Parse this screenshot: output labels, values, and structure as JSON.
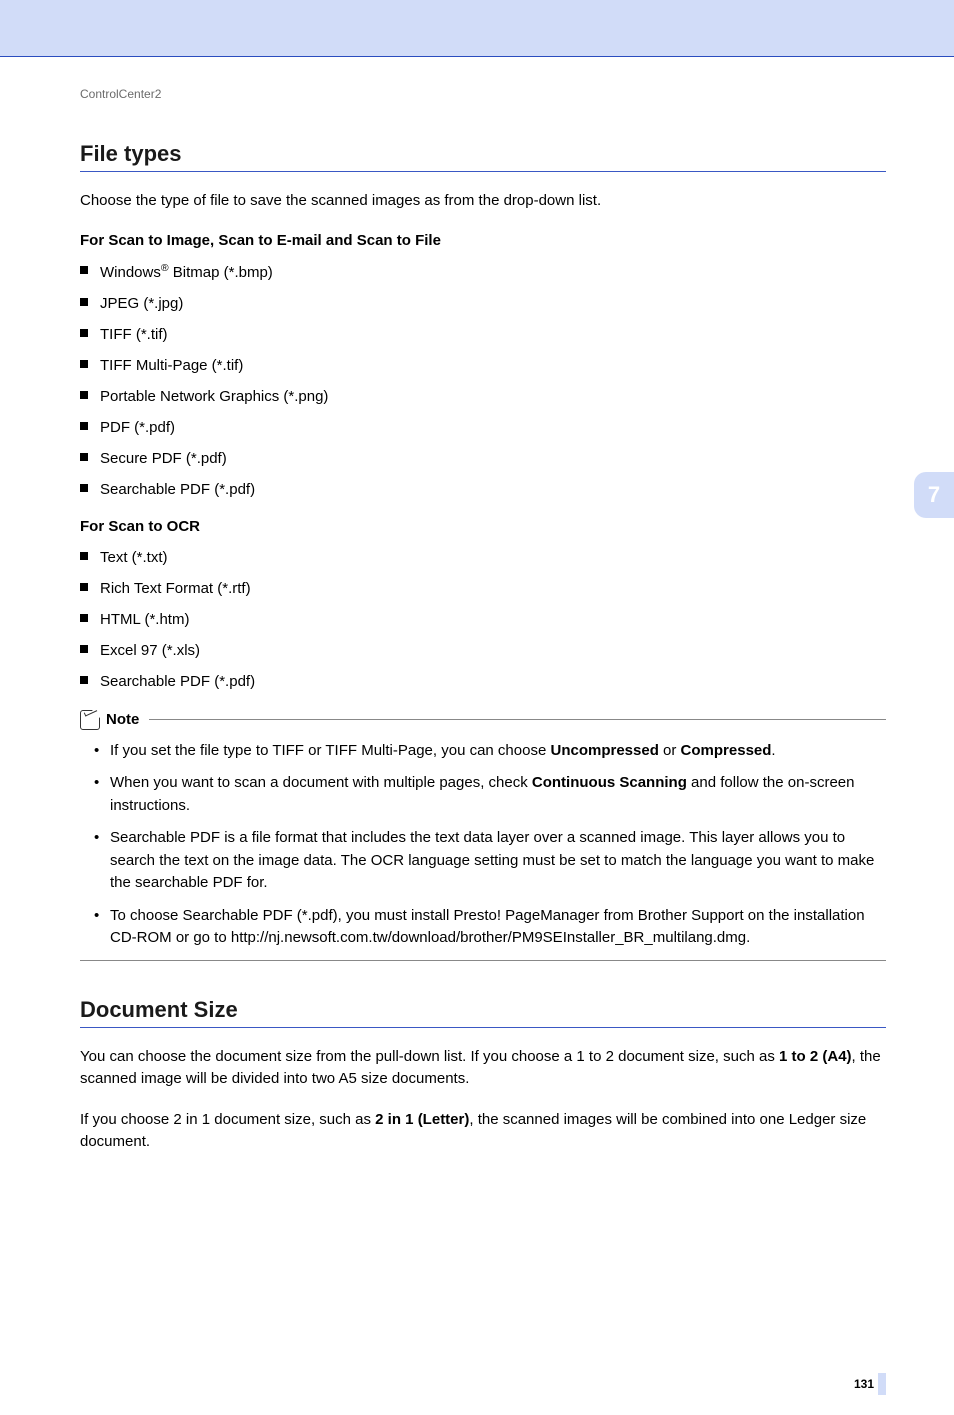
{
  "breadcrumb": "ControlCenter2",
  "chapter_tab": "7",
  "page_number": "131",
  "section1": {
    "heading": "File types",
    "intro": "Choose the type of file to save the scanned images as from the drop-down list.",
    "sub1_title": "For Scan to Image, Scan to E-mail and Scan to File",
    "sub1_items_prefix0": "Windows",
    "sub1_items_sup0": "®",
    "sub1_items_suffix0": " Bitmap (*.bmp)",
    "sub1_items": [
      "JPEG (*.jpg)",
      "TIFF (*.tif)",
      "TIFF Multi-Page (*.tif)",
      "Portable Network Graphics (*.png)",
      "PDF (*.pdf)",
      "Secure PDF (*.pdf)",
      "Searchable PDF (*.pdf)"
    ],
    "sub2_title": "For Scan to OCR",
    "sub2_items": [
      "Text (*.txt)",
      "Rich Text Format (*.rtf)",
      "HTML (*.htm)",
      "Excel 97 (*.xls)",
      "Searchable PDF (*.pdf)"
    ]
  },
  "note": {
    "label": "Note",
    "item1_a": "If you set the file type to TIFF or TIFF Multi-Page, you can choose ",
    "item1_b": "Uncompressed",
    "item1_c": " or ",
    "item1_d": "Compressed",
    "item1_e": ".",
    "item2_a": "When you want to scan a document with multiple pages, check ",
    "item2_b": "Continuous Scanning",
    "item2_c": " and follow the on-screen instructions.",
    "item3": "Searchable PDF is a file format that includes the text data layer over a scanned image. This layer allows you to search the text on the image data. The OCR language setting must be set to match the language you want to make the searchable PDF for.",
    "item4": "To choose Searchable PDF (*.pdf), you must install Presto! PageManager from Brother Support on the installation CD-ROM or go to http://nj.newsoft.com.tw/download/brother/PM9SEInstaller_BR_multilang.dmg."
  },
  "section2": {
    "heading": "Document Size",
    "para1_a": "You can choose the document size from the pull-down list. If you choose a 1 to 2 document size, such as ",
    "para1_b": "1 to 2 (A4)",
    "para1_c": ", the scanned image will be divided into two A5 size documents.",
    "para2_a": "If you choose 2 in 1 document size, such as ",
    "para2_b": "2 in 1 (Letter)",
    "para2_c": ", the scanned images will be combined into one Ledger size document."
  }
}
